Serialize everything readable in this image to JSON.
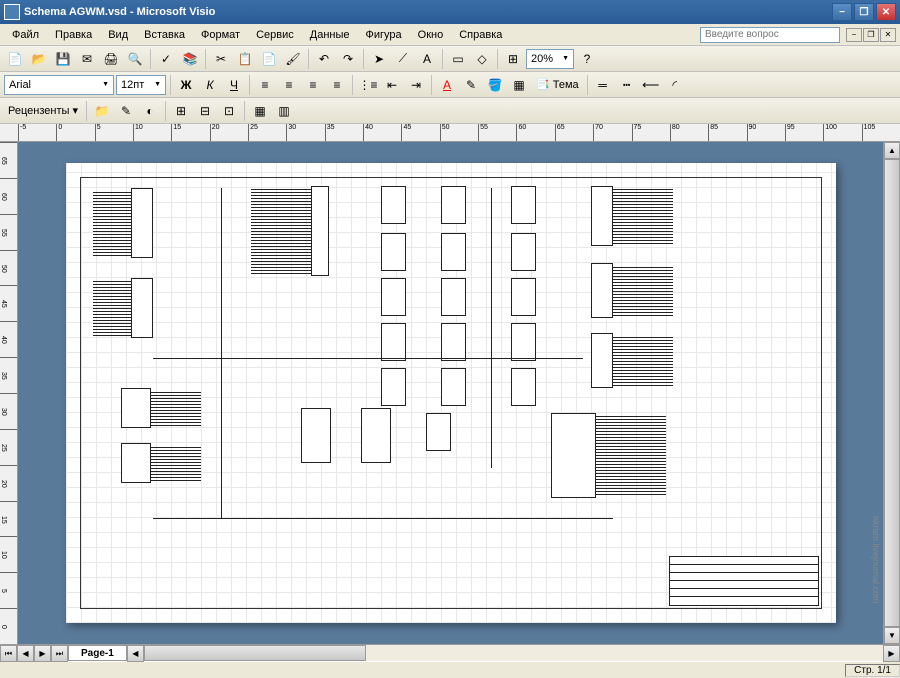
{
  "titlebar": {
    "text": "Schema AGWM.vsd - Microsoft Visio"
  },
  "menu": {
    "file": "Файл",
    "edit": "Правка",
    "view": "Вид",
    "insert": "Вставка",
    "format": "Формат",
    "service": "Сервис",
    "data": "Данные",
    "shape": "Фигура",
    "window": "Окно",
    "help": "Справка"
  },
  "help_placeholder": "Введите вопрос",
  "format_bar": {
    "font": "Arial",
    "size": "12пт",
    "theme_label": "Тема"
  },
  "zoom": "20%",
  "reviewers": "Рецензенты",
  "page_tab": "Page-1",
  "status": {
    "page": "Стр. 1/1"
  },
  "ruler_h": [
    "-5",
    "0",
    "5",
    "10",
    "15",
    "20",
    "25",
    "30",
    "35",
    "40",
    "45",
    "50",
    "55",
    "60",
    "65",
    "70",
    "75",
    "80",
    "85",
    "90",
    "95",
    "100",
    "105"
  ],
  "ruler_v": [
    "65",
    "60",
    "55",
    "50",
    "45",
    "40",
    "35",
    "30",
    "25",
    "20",
    "15",
    "10",
    "5",
    "0"
  ],
  "watermark": "nkram.livejournal.com"
}
